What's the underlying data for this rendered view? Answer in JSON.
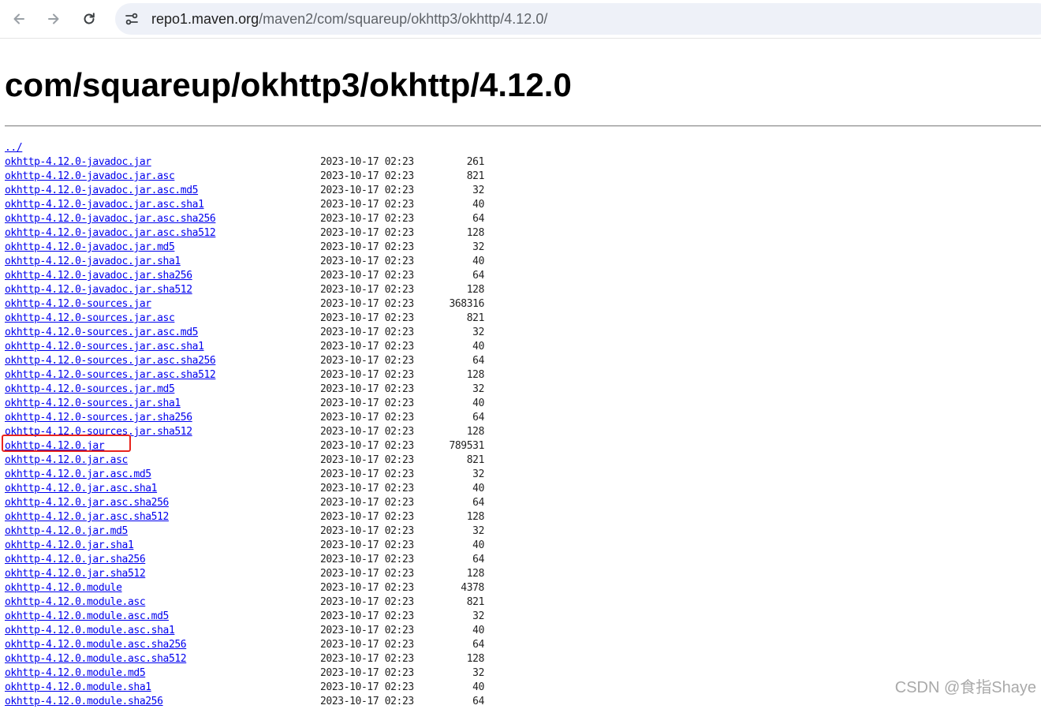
{
  "browser": {
    "url_host": "repo1.maven.org",
    "url_path": "/maven2/com/squareup/okhttp3/okhttp/4.12.0/",
    "icons": [
      "back-arrow-icon",
      "forward-arrow-icon",
      "reload-icon",
      "site-info-icon"
    ]
  },
  "page": {
    "title": "com/squareup/okhttp3/okhttp/4.12.0",
    "parent_link": "../",
    "files": [
      {
        "name": "okhttp-4.12.0-javadoc.jar",
        "date": "2023-10-17 02:23",
        "size": "261"
      },
      {
        "name": "okhttp-4.12.0-javadoc.jar.asc",
        "date": "2023-10-17 02:23",
        "size": "821"
      },
      {
        "name": "okhttp-4.12.0-javadoc.jar.asc.md5",
        "date": "2023-10-17 02:23",
        "size": "32"
      },
      {
        "name": "okhttp-4.12.0-javadoc.jar.asc.sha1",
        "date": "2023-10-17 02:23",
        "size": "40"
      },
      {
        "name": "okhttp-4.12.0-javadoc.jar.asc.sha256",
        "date": "2023-10-17 02:23",
        "size": "64"
      },
      {
        "name": "okhttp-4.12.0-javadoc.jar.asc.sha512",
        "date": "2023-10-17 02:23",
        "size": "128"
      },
      {
        "name": "okhttp-4.12.0-javadoc.jar.md5",
        "date": "2023-10-17 02:23",
        "size": "32"
      },
      {
        "name": "okhttp-4.12.0-javadoc.jar.sha1",
        "date": "2023-10-17 02:23",
        "size": "40"
      },
      {
        "name": "okhttp-4.12.0-javadoc.jar.sha256",
        "date": "2023-10-17 02:23",
        "size": "64"
      },
      {
        "name": "okhttp-4.12.0-javadoc.jar.sha512",
        "date": "2023-10-17 02:23",
        "size": "128"
      },
      {
        "name": "okhttp-4.12.0-sources.jar",
        "date": "2023-10-17 02:23",
        "size": "368316"
      },
      {
        "name": "okhttp-4.12.0-sources.jar.asc",
        "date": "2023-10-17 02:23",
        "size": "821"
      },
      {
        "name": "okhttp-4.12.0-sources.jar.asc.md5",
        "date": "2023-10-17 02:23",
        "size": "32"
      },
      {
        "name": "okhttp-4.12.0-sources.jar.asc.sha1",
        "date": "2023-10-17 02:23",
        "size": "40"
      },
      {
        "name": "okhttp-4.12.0-sources.jar.asc.sha256",
        "date": "2023-10-17 02:23",
        "size": "64"
      },
      {
        "name": "okhttp-4.12.0-sources.jar.asc.sha512",
        "date": "2023-10-17 02:23",
        "size": "128"
      },
      {
        "name": "okhttp-4.12.0-sources.jar.md5",
        "date": "2023-10-17 02:23",
        "size": "32"
      },
      {
        "name": "okhttp-4.12.0-sources.jar.sha1",
        "date": "2023-10-17 02:23",
        "size": "40"
      },
      {
        "name": "okhttp-4.12.0-sources.jar.sha256",
        "date": "2023-10-17 02:23",
        "size": "64"
      },
      {
        "name": "okhttp-4.12.0-sources.jar.sha512",
        "date": "2023-10-17 02:23",
        "size": "128"
      },
      {
        "name": "okhttp-4.12.0.jar",
        "date": "2023-10-17 02:23",
        "size": "789531"
      },
      {
        "name": "okhttp-4.12.0.jar.asc",
        "date": "2023-10-17 02:23",
        "size": "821"
      },
      {
        "name": "okhttp-4.12.0.jar.asc.md5",
        "date": "2023-10-17 02:23",
        "size": "32"
      },
      {
        "name": "okhttp-4.12.0.jar.asc.sha1",
        "date": "2023-10-17 02:23",
        "size": "40"
      },
      {
        "name": "okhttp-4.12.0.jar.asc.sha256",
        "date": "2023-10-17 02:23",
        "size": "64"
      },
      {
        "name": "okhttp-4.12.0.jar.asc.sha512",
        "date": "2023-10-17 02:23",
        "size": "128"
      },
      {
        "name": "okhttp-4.12.0.jar.md5",
        "date": "2023-10-17 02:23",
        "size": "32"
      },
      {
        "name": "okhttp-4.12.0.jar.sha1",
        "date": "2023-10-17 02:23",
        "size": "40"
      },
      {
        "name": "okhttp-4.12.0.jar.sha256",
        "date": "2023-10-17 02:23",
        "size": "64"
      },
      {
        "name": "okhttp-4.12.0.jar.sha512",
        "date": "2023-10-17 02:23",
        "size": "128"
      },
      {
        "name": "okhttp-4.12.0.module",
        "date": "2023-10-17 02:23",
        "size": "4378"
      },
      {
        "name": "okhttp-4.12.0.module.asc",
        "date": "2023-10-17 02:23",
        "size": "821"
      },
      {
        "name": "okhttp-4.12.0.module.asc.md5",
        "date": "2023-10-17 02:23",
        "size": "32"
      },
      {
        "name": "okhttp-4.12.0.module.asc.sha1",
        "date": "2023-10-17 02:23",
        "size": "40"
      },
      {
        "name": "okhttp-4.12.0.module.asc.sha256",
        "date": "2023-10-17 02:23",
        "size": "64"
      },
      {
        "name": "okhttp-4.12.0.module.asc.sha512",
        "date": "2023-10-17 02:23",
        "size": "128"
      },
      {
        "name": "okhttp-4.12.0.module.md5",
        "date": "2023-10-17 02:23",
        "size": "32"
      },
      {
        "name": "okhttp-4.12.0.module.sha1",
        "date": "2023-10-17 02:23",
        "size": "40"
      },
      {
        "name": "okhttp-4.12.0.module.sha256",
        "date": "2023-10-17 02:23",
        "size": "64"
      }
    ]
  },
  "watermark": "CSDN @食指Shaye",
  "colors": {
    "link": "#0000ee",
    "highlight": "#e8241d",
    "omnibox": "#eef1f8"
  }
}
